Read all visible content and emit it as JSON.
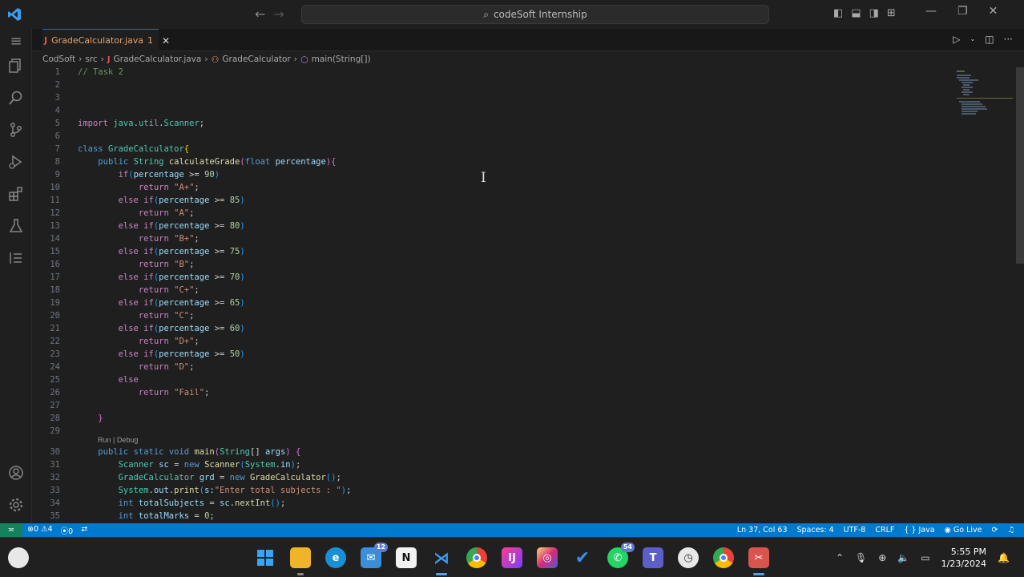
{
  "titlebar": {
    "search_text": "codeSoft Internship"
  },
  "tab": {
    "filename": "GradeCalculator.java",
    "problems": "1",
    "lang_icon": "J"
  },
  "breadcrumb": {
    "items": [
      "CodSoft",
      "src",
      "GradeCalculator.java",
      "GradeCalculator",
      "main(String[])"
    ]
  },
  "editor": {
    "codelens": "Run | Debug",
    "lines": [
      {
        "n": "1"
      },
      {
        "n": "2"
      },
      {
        "n": "3"
      },
      {
        "n": "4"
      },
      {
        "n": "5"
      },
      {
        "n": "6"
      },
      {
        "n": "7"
      },
      {
        "n": "8"
      },
      {
        "n": "9"
      },
      {
        "n": "10"
      },
      {
        "n": "11"
      },
      {
        "n": "12"
      },
      {
        "n": "13"
      },
      {
        "n": "14"
      },
      {
        "n": "15"
      },
      {
        "n": "16"
      },
      {
        "n": "17"
      },
      {
        "n": "18"
      },
      {
        "n": "19"
      },
      {
        "n": "20"
      },
      {
        "n": "21"
      },
      {
        "n": "22"
      },
      {
        "n": "23"
      },
      {
        "n": "24"
      },
      {
        "n": "25"
      },
      {
        "n": "26"
      },
      {
        "n": "27"
      },
      {
        "n": "28"
      },
      {
        "n": "29"
      },
      {
        "n": "30"
      },
      {
        "n": "31"
      },
      {
        "n": "32"
      },
      {
        "n": "33"
      },
      {
        "n": "34"
      },
      {
        "n": "35"
      }
    ]
  },
  "statusbar": {
    "errors": "0",
    "warnings": "4",
    "ports": "0",
    "position": "Ln 37, Col 63",
    "spaces": "Spaces: 4",
    "encoding": "UTF-8",
    "eol": "CRLF",
    "language": "Java",
    "golive": "Go Live"
  },
  "taskbar": {
    "mail_badge": "12",
    "whatsapp_badge": "54",
    "time": "5:55 PM",
    "date": "1/23/2024"
  },
  "colors": {
    "accent": "#007acc",
    "remote": "#16825d",
    "editor_bg": "#1f1f1f"
  }
}
